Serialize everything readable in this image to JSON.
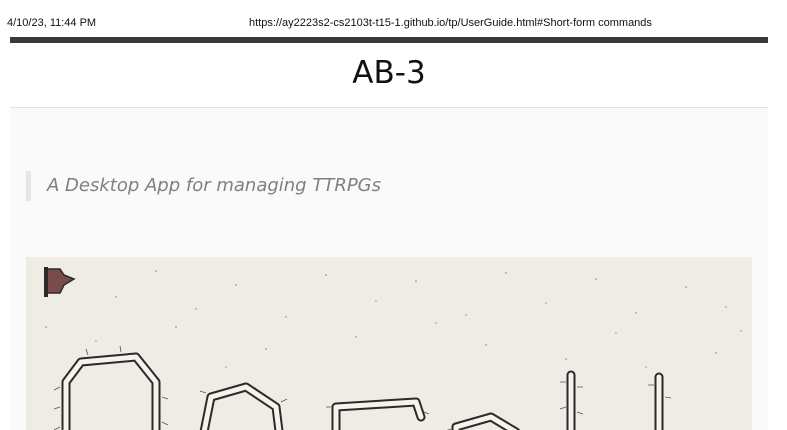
{
  "print_header": {
    "date": "4/10/23, 11:44 PM",
    "url": "https://ay2223s2-cs2103t-t15-1.github.io/tp/UserGuide.html#Short-form commands"
  },
  "site": {
    "title": "AB-3",
    "tagline": "A Desktop App for managing TTRPGs"
  },
  "banner": {
    "image": "dungeon-map-logo",
    "colors": {
      "paper": "#efebe5",
      "wall": "#2a2a2a",
      "floor": "#f6f3ec",
      "grid": "#bdb6aa",
      "emblem": "#7a4b4b"
    }
  }
}
